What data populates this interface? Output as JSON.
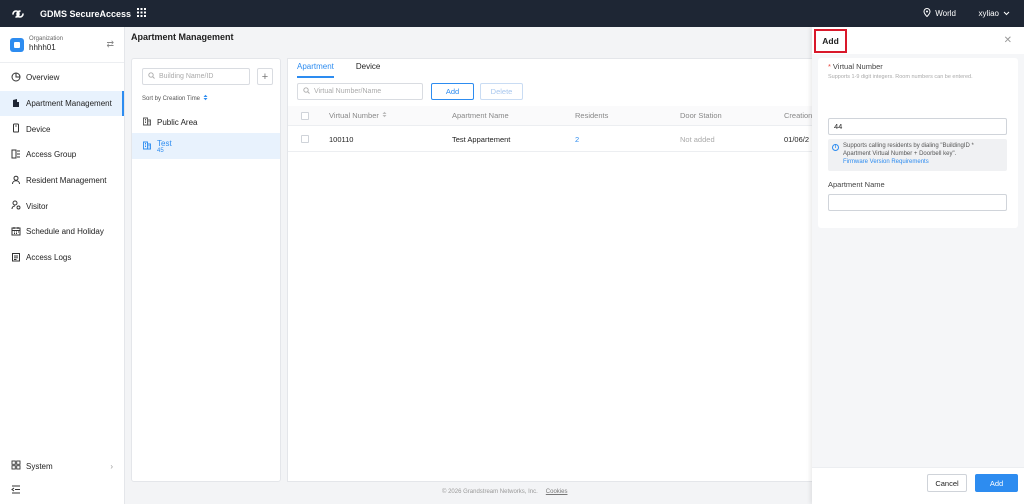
{
  "topbar": {
    "app_title": "GDMS SecureAccess",
    "region": "World",
    "user": "xyliao"
  },
  "org": {
    "label": "Organization",
    "name": "hhhh01"
  },
  "nav": [
    {
      "label": "Overview"
    },
    {
      "label": "Apartment Management"
    },
    {
      "label": "Device"
    },
    {
      "label": "Access Group"
    },
    {
      "label": "Resident Management"
    },
    {
      "label": "Visitor"
    },
    {
      "label": "Schedule and Holiday"
    },
    {
      "label": "Access Logs"
    }
  ],
  "system_label": "System",
  "page_title": "Apartment Management",
  "buildings": {
    "search_placeholder": "Building Name/ID",
    "sort_label": "Sort by Creation Time",
    "items": [
      {
        "name": "Public Area",
        "sub": ""
      },
      {
        "name": "Test",
        "sub": "45"
      }
    ]
  },
  "tabs": [
    {
      "label": "Apartment"
    },
    {
      "label": "Device"
    }
  ],
  "toolbar": {
    "search_placeholder": "Virtual Number/Name",
    "add_label": "Add",
    "delete_label": "Delete"
  },
  "table": {
    "headers": [
      "Virtual Number",
      "Apartment Name",
      "Residents",
      "Door Station",
      "Creation"
    ],
    "rows": [
      {
        "virtual_number": "100110",
        "apartment_name": "Test Appartement",
        "residents": "2",
        "door_station": "Not added",
        "creation": "01/06/2"
      }
    ]
  },
  "footer": {
    "copyright": "© 2026 Grandstream Networks, Inc.",
    "cookies": "Cookies"
  },
  "drawer": {
    "title": "Add",
    "virtual_number_label": "Virtual Number",
    "virtual_number_hint": "Supports 1-9 digit integers. Room numbers can be entered.",
    "virtual_number_value": "44",
    "info_text": "Supports calling residents by dialing \"BuildingID * Apartment Virtual Number + Doorbell key\".",
    "info_link": "Firmware Version Requirements",
    "apartment_name_label": "Apartment Name",
    "apartment_name_value": "",
    "cancel_label": "Cancel",
    "add_label": "Add"
  },
  "colors": {
    "primary": "#2d8cf0",
    "topbar": "#1e2634",
    "highlight_box": "#d9182a"
  }
}
